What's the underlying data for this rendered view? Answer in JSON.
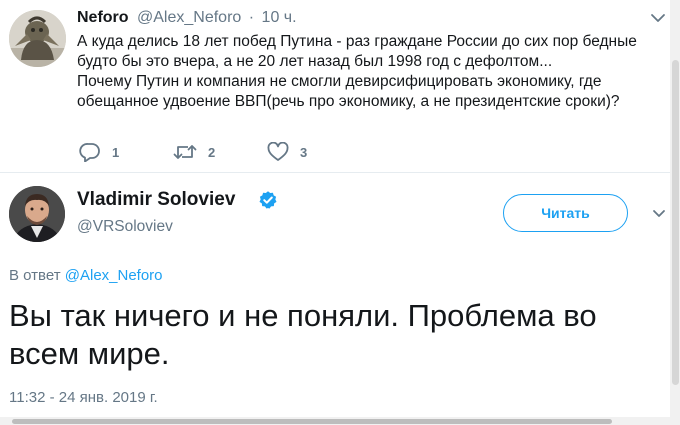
{
  "reply_tweet": {
    "author_name": "Neforo",
    "author_handle": "@Alex_Neforo",
    "separator": "·",
    "time": "10 ч.",
    "text_lines": [
      "А куда делись 18 лет побед Путина - раз граждане России до сих пор бедные",
      "будто бы это вчера, а не 20 лет назад был 1998 год с дефолтом...",
      "Почему Путин и компания не смогли девирсифицировать экономику, где",
      "обещанное удвоение ВВП(речь про экономику, а не президентские сроки)?"
    ],
    "reply_count": "1",
    "retweet_count": "2",
    "like_count": "3"
  },
  "main_tweet": {
    "author_name": "Vladimir Soloviev",
    "author_handle": "@VRSoloviev",
    "follow_label": "Читать",
    "reply_prefix": "В ответ",
    "reply_mention": "@Alex_Neforo",
    "text_lines": [
      "Вы так ничего и не поняли. Проблема во",
      "всем мире."
    ],
    "timestamp": "11:32 - 24 янв. 2019 г."
  },
  "colors": {
    "accent": "#1da1f2",
    "secondary_text": "#657786",
    "primary_text": "#14171a"
  },
  "icons": {
    "reply": "reply-icon",
    "retweet": "retweet-icon",
    "like": "heart-icon",
    "verified": "verified-badge-icon",
    "caret": "chevron-down-icon"
  }
}
